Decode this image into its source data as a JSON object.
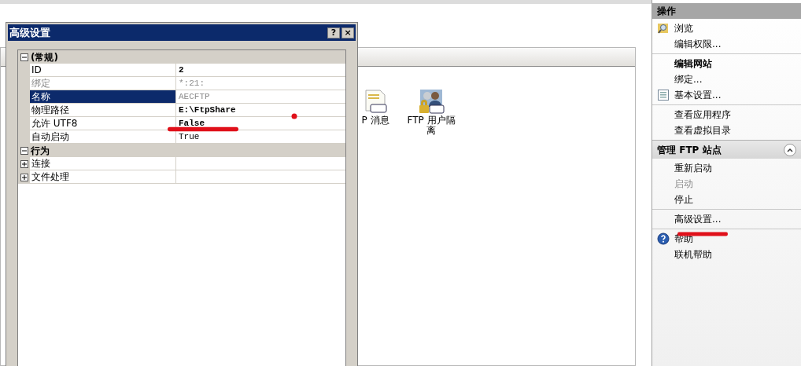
{
  "features": [
    {
      "label": "P 消息",
      "kind": "message"
    },
    {
      "label": "FTP 用户隔离",
      "kind": "users"
    }
  ],
  "dialog": {
    "title": "高级设置",
    "buttons": [
      "?",
      "×"
    ],
    "groups": [
      {
        "label": "(常规)",
        "expanded": true,
        "properties": [
          {
            "name": "ID",
            "value": "2",
            "bold": true,
            "disabled": false,
            "selected": false
          },
          {
            "name": "绑定",
            "value": "*:21:",
            "bold": false,
            "disabled": true,
            "selected": false
          },
          {
            "name": "名称",
            "value": "AECFTP",
            "bold": false,
            "disabled": true,
            "selected": true
          },
          {
            "name": "物理路径",
            "value": "E:\\FtpShare",
            "bold": true,
            "disabled": false,
            "selected": false
          },
          {
            "name": "允许 UTF8",
            "value": "False",
            "bold": true,
            "disabled": false,
            "selected": false
          },
          {
            "name": "自动启动",
            "value": "True",
            "bold": false,
            "disabled": false,
            "selected": false
          }
        ]
      },
      {
        "label": "行为",
        "expanded": true,
        "properties": [
          {
            "name": "连接",
            "expanded": false,
            "bold": false,
            "disabled": false,
            "selected": false
          },
          {
            "name": "文件处理",
            "expanded": false,
            "bold": false,
            "disabled": false,
            "selected": false
          }
        ]
      }
    ]
  },
  "actions": {
    "title": "操作",
    "groups": [
      {
        "items": [
          {
            "label": "浏览",
            "kind": "browse",
            "disabled": false
          },
          {
            "label": "编辑权限...",
            "disabled": false
          }
        ]
      },
      {
        "heading": "编辑网站",
        "items": [
          {
            "label": "绑定...",
            "disabled": false
          },
          {
            "label": "基本设置...",
            "kind": "settings",
            "disabled": false
          }
        ]
      },
      {
        "items": [
          {
            "label": "查看应用程序",
            "disabled": false
          },
          {
            "label": "查看虚拟目录",
            "disabled": false
          }
        ]
      }
    ],
    "sections": [
      {
        "title": "管理 FTP 站点",
        "expanded": true,
        "groups": [
          {
            "items": [
              {
                "label": "重新启动",
                "disabled": false
              },
              {
                "label": "启动",
                "disabled": true
              },
              {
                "label": "停止",
                "disabled": false
              }
            ]
          },
          {
            "items": [
              {
                "label": "高级设置...",
                "disabled": false
              }
            ]
          },
          {
            "items": [
              {
                "label": "帮助",
                "kind": "help",
                "disabled": false
              },
              {
                "label": "联机帮助",
                "disabled": false
              }
            ]
          }
        ]
      }
    ]
  }
}
